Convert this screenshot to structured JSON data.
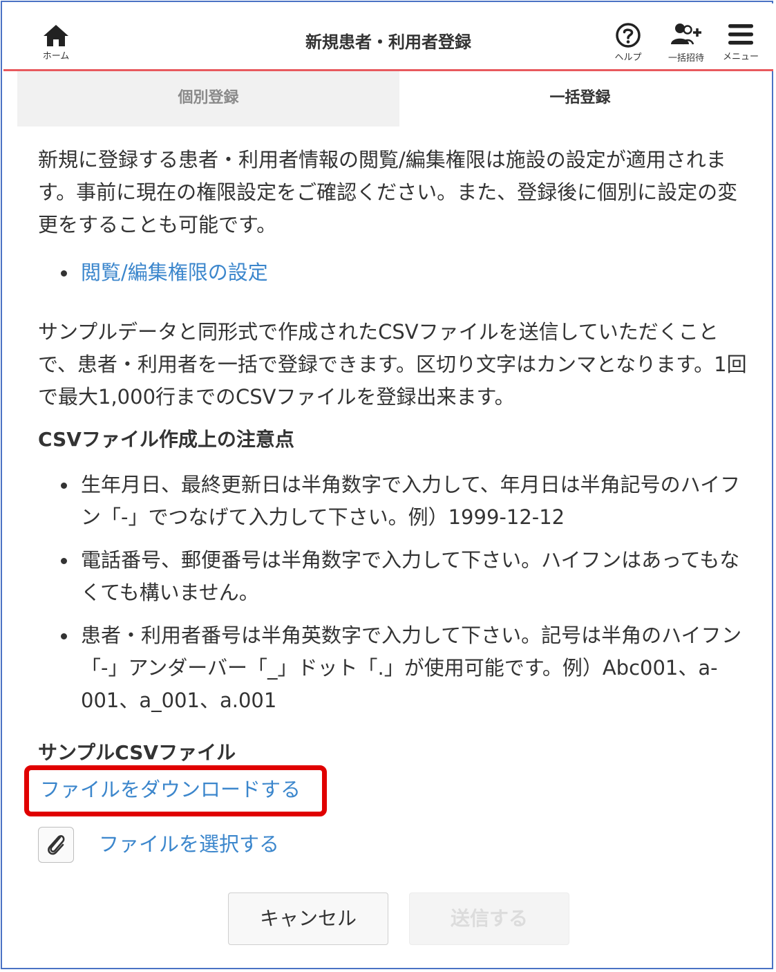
{
  "header": {
    "title": "新規患者・利用者登録",
    "home_label": "ホーム",
    "help_label": "ヘルプ",
    "invite_label": "一括招待",
    "menu_label": "メニュー"
  },
  "tabs": {
    "individual": "個別登録",
    "bulk": "一括登録"
  },
  "content": {
    "intro": "新規に登録する患者・利用者情報の閲覧/編集権限は施設の設定が適用されます。事前に現在の権限設定をご確認ください。また、登録後に個別に設定の変更をすることも可能です。",
    "permission_link": "閲覧/編集権限の設定",
    "csv_description": "サンプルデータと同形式で作成されたCSVファイルを送信していただくことで、患者・利用者を一括で登録できます。区切り文字はカンマとなります。1回で最大1,000行までのCSVファイルを登録出来ます。",
    "notes_heading": "CSVファイル作成上の注意点",
    "notes": [
      "生年月日、最終更新日は半角数字で入力して、年月日は半角記号のハイフン「-」でつなげて入力して下さい。例）1999-12-12",
      "電話番号、郵便番号は半角数字で入力して下さい。ハイフンはあってもなくても構いません。",
      "患者・利用者番号は半角英数字で入力して下さい。記号は半角のハイフン「-」アンダーバー「_」ドット「.」が使用可能です。例）Abc001、a-001、a_001、a.001"
    ],
    "sample_heading": "サンプルCSVファイル",
    "download_link": "ファイルをダウンロードする",
    "select_file_link": "ファイルを選択する"
  },
  "buttons": {
    "cancel": "キャンセル",
    "submit": "送信する"
  },
  "colors": {
    "link": "#3b86cc",
    "header_rule": "#e8595e",
    "highlight_box": "#e00000",
    "frame_border": "#4a72c4"
  }
}
